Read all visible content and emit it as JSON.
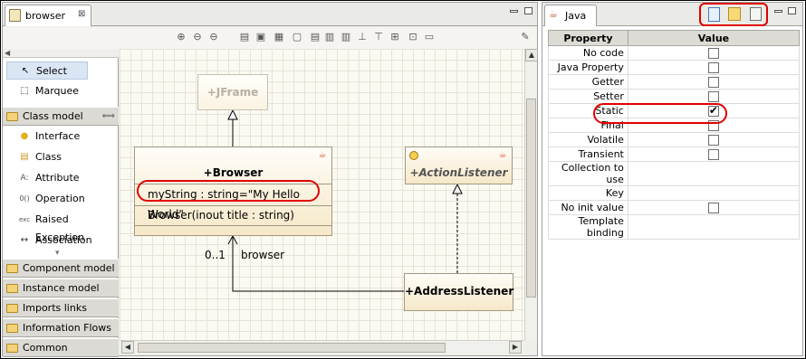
{
  "editor": {
    "tab_label": "browser",
    "tab_close": "⊠"
  },
  "toolbar": {
    "tools": [
      "⊕",
      "⊖",
      "⊖",
      "▤",
      "▣",
      "▦",
      "▢",
      "▤",
      "▥",
      "▥",
      "⊥",
      "⊤",
      "⊞",
      "⊡",
      "▭",
      "✎"
    ]
  },
  "palette": {
    "tools": [
      {
        "label": "Select",
        "icon": "↖"
      },
      {
        "label": "Marquee",
        "icon": "⬚"
      }
    ],
    "class_model_header": "Class model",
    "class_model_collapse": "⟺",
    "items": [
      {
        "label": "Interface",
        "icon": "●"
      },
      {
        "label": "Class",
        "icon": "▤"
      },
      {
        "label": "Attribute",
        "icon": "A:"
      },
      {
        "label": "Operation",
        "icon": "0()"
      },
      {
        "label": "Raised Exception",
        "icon": "exc"
      },
      {
        "label": "Association",
        "icon": "↔"
      }
    ],
    "more_arrow": "▾",
    "drawers": [
      "Component model",
      "Instance model",
      "Imports links",
      "Information Flows",
      "Common"
    ]
  },
  "diagram": {
    "jframe": "+JFrame",
    "browser_title": "+Browser",
    "browser_attribute": "myString : string=\"My Hello World\"",
    "browser_operation": "Browser(inout title : string)",
    "action_listener": "+ActionListener",
    "address_listener": "+AddressListener",
    "multiplicity": "0..1",
    "role": "browser",
    "java_badge": "☕"
  },
  "properties": {
    "tab_label": "Java",
    "header_property": "Property",
    "header_value": "Value",
    "rows": [
      {
        "name": "No code",
        "type": "checkbox",
        "checked": false
      },
      {
        "name": "Java Property",
        "type": "checkbox",
        "checked": false
      },
      {
        "name": "Getter",
        "type": "checkbox",
        "checked": false
      },
      {
        "name": "Setter",
        "type": "checkbox",
        "checked": false
      },
      {
        "name": "Static",
        "type": "checkbox",
        "checked": true
      },
      {
        "name": "Final",
        "type": "checkbox",
        "checked": false
      },
      {
        "name": "Volatile",
        "type": "checkbox",
        "checked": false
      },
      {
        "name": "Transient",
        "type": "checkbox",
        "checked": false
      },
      {
        "name": "Collection to use",
        "type": "text",
        "value": ""
      },
      {
        "name": "Key",
        "type": "text",
        "value": ""
      },
      {
        "name": "No init value",
        "type": "checkbox",
        "checked": false
      },
      {
        "name": "Template binding",
        "type": "text",
        "value": ""
      }
    ]
  },
  "colors": {
    "highlight": "#e00000",
    "class_fill": "#f6e8c8"
  }
}
